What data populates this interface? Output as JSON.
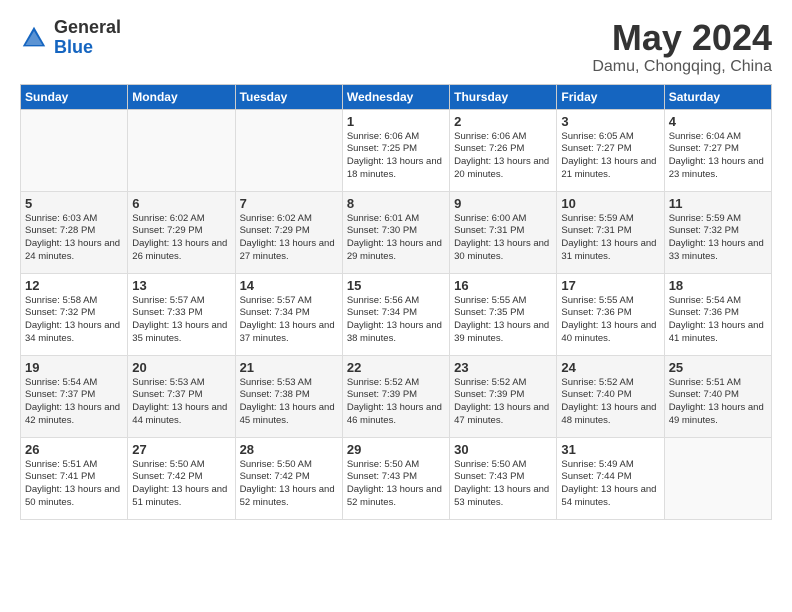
{
  "logo": {
    "general": "General",
    "blue": "Blue"
  },
  "title": "May 2024",
  "location": "Damu, Chongqing, China",
  "days_of_week": [
    "Sunday",
    "Monday",
    "Tuesday",
    "Wednesday",
    "Thursday",
    "Friday",
    "Saturday"
  ],
  "weeks": [
    [
      {
        "day": "",
        "content": ""
      },
      {
        "day": "",
        "content": ""
      },
      {
        "day": "",
        "content": ""
      },
      {
        "day": "1",
        "content": "Sunrise: 6:06 AM\nSunset: 7:25 PM\nDaylight: 13 hours\nand 18 minutes."
      },
      {
        "day": "2",
        "content": "Sunrise: 6:06 AM\nSunset: 7:26 PM\nDaylight: 13 hours\nand 20 minutes."
      },
      {
        "day": "3",
        "content": "Sunrise: 6:05 AM\nSunset: 7:27 PM\nDaylight: 13 hours\nand 21 minutes."
      },
      {
        "day": "4",
        "content": "Sunrise: 6:04 AM\nSunset: 7:27 PM\nDaylight: 13 hours\nand 23 minutes."
      }
    ],
    [
      {
        "day": "5",
        "content": "Sunrise: 6:03 AM\nSunset: 7:28 PM\nDaylight: 13 hours\nand 24 minutes."
      },
      {
        "day": "6",
        "content": "Sunrise: 6:02 AM\nSunset: 7:29 PM\nDaylight: 13 hours\nand 26 minutes."
      },
      {
        "day": "7",
        "content": "Sunrise: 6:02 AM\nSunset: 7:29 PM\nDaylight: 13 hours\nand 27 minutes."
      },
      {
        "day": "8",
        "content": "Sunrise: 6:01 AM\nSunset: 7:30 PM\nDaylight: 13 hours\nand 29 minutes."
      },
      {
        "day": "9",
        "content": "Sunrise: 6:00 AM\nSunset: 7:31 PM\nDaylight: 13 hours\nand 30 minutes."
      },
      {
        "day": "10",
        "content": "Sunrise: 5:59 AM\nSunset: 7:31 PM\nDaylight: 13 hours\nand 31 minutes."
      },
      {
        "day": "11",
        "content": "Sunrise: 5:59 AM\nSunset: 7:32 PM\nDaylight: 13 hours\nand 33 minutes."
      }
    ],
    [
      {
        "day": "12",
        "content": "Sunrise: 5:58 AM\nSunset: 7:32 PM\nDaylight: 13 hours\nand 34 minutes."
      },
      {
        "day": "13",
        "content": "Sunrise: 5:57 AM\nSunset: 7:33 PM\nDaylight: 13 hours\nand 35 minutes."
      },
      {
        "day": "14",
        "content": "Sunrise: 5:57 AM\nSunset: 7:34 PM\nDaylight: 13 hours\nand 37 minutes."
      },
      {
        "day": "15",
        "content": "Sunrise: 5:56 AM\nSunset: 7:34 PM\nDaylight: 13 hours\nand 38 minutes."
      },
      {
        "day": "16",
        "content": "Sunrise: 5:55 AM\nSunset: 7:35 PM\nDaylight: 13 hours\nand 39 minutes."
      },
      {
        "day": "17",
        "content": "Sunrise: 5:55 AM\nSunset: 7:36 PM\nDaylight: 13 hours\nand 40 minutes."
      },
      {
        "day": "18",
        "content": "Sunrise: 5:54 AM\nSunset: 7:36 PM\nDaylight: 13 hours\nand 41 minutes."
      }
    ],
    [
      {
        "day": "19",
        "content": "Sunrise: 5:54 AM\nSunset: 7:37 PM\nDaylight: 13 hours\nand 42 minutes."
      },
      {
        "day": "20",
        "content": "Sunrise: 5:53 AM\nSunset: 7:37 PM\nDaylight: 13 hours\nand 44 minutes."
      },
      {
        "day": "21",
        "content": "Sunrise: 5:53 AM\nSunset: 7:38 PM\nDaylight: 13 hours\nand 45 minutes."
      },
      {
        "day": "22",
        "content": "Sunrise: 5:52 AM\nSunset: 7:39 PM\nDaylight: 13 hours\nand 46 minutes."
      },
      {
        "day": "23",
        "content": "Sunrise: 5:52 AM\nSunset: 7:39 PM\nDaylight: 13 hours\nand 47 minutes."
      },
      {
        "day": "24",
        "content": "Sunrise: 5:52 AM\nSunset: 7:40 PM\nDaylight: 13 hours\nand 48 minutes."
      },
      {
        "day": "25",
        "content": "Sunrise: 5:51 AM\nSunset: 7:40 PM\nDaylight: 13 hours\nand 49 minutes."
      }
    ],
    [
      {
        "day": "26",
        "content": "Sunrise: 5:51 AM\nSunset: 7:41 PM\nDaylight: 13 hours\nand 50 minutes."
      },
      {
        "day": "27",
        "content": "Sunrise: 5:50 AM\nSunset: 7:42 PM\nDaylight: 13 hours\nand 51 minutes."
      },
      {
        "day": "28",
        "content": "Sunrise: 5:50 AM\nSunset: 7:42 PM\nDaylight: 13 hours\nand 52 minutes."
      },
      {
        "day": "29",
        "content": "Sunrise: 5:50 AM\nSunset: 7:43 PM\nDaylight: 13 hours\nand 52 minutes."
      },
      {
        "day": "30",
        "content": "Sunrise: 5:50 AM\nSunset: 7:43 PM\nDaylight: 13 hours\nand 53 minutes."
      },
      {
        "day": "31",
        "content": "Sunrise: 5:49 AM\nSunset: 7:44 PM\nDaylight: 13 hours\nand 54 minutes."
      },
      {
        "day": "",
        "content": ""
      }
    ]
  ]
}
